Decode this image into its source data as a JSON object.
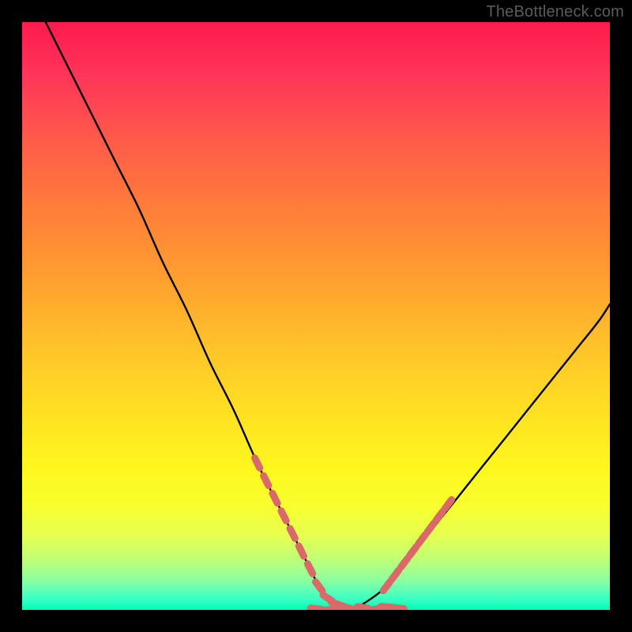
{
  "watermark": "TheBottleneck.com",
  "chart_data": {
    "type": "line",
    "title": "",
    "xlabel": "",
    "ylabel": "",
    "xlim": [
      0,
      100
    ],
    "ylim": [
      0,
      100
    ],
    "grid": false,
    "legend": false,
    "series": [
      {
        "name": "curve",
        "x": [
          4,
          8,
          12,
          16,
          20,
          24,
          28,
          32,
          36,
          40,
          44,
          48,
          50,
          52,
          54,
          56,
          58,
          62,
          66,
          70,
          74,
          78,
          82,
          86,
          90,
          94,
          98,
          100
        ],
        "y": [
          100,
          92,
          84,
          76,
          68,
          59,
          51,
          42,
          34,
          25,
          17,
          9,
          5,
          2,
          1,
          0,
          1,
          4,
          9,
          14,
          19,
          24,
          29,
          34,
          39,
          44,
          49,
          52
        ]
      }
    ],
    "highlight_segments": [
      {
        "name": "left-dotted",
        "x": [
          40,
          41.5,
          43,
          44.5,
          46,
          47.5,
          49,
          50.5,
          52,
          53.5,
          55,
          56.5
        ],
        "y": [
          25,
          22,
          19,
          16,
          13,
          10,
          7,
          4,
          2,
          1,
          0.5,
          0
        ]
      },
      {
        "name": "right-dotted",
        "x": [
          62,
          63.5,
          65,
          66.5,
          68,
          69.5,
          71,
          72.5
        ],
        "y": [
          4,
          6,
          8,
          10,
          12,
          14,
          16,
          18
        ]
      },
      {
        "name": "bottom-dotted",
        "x": [
          50,
          52,
          54,
          56,
          58,
          60,
          62,
          64
        ],
        "y": [
          0.2,
          0.0,
          0.3,
          0.0,
          0.4,
          0.1,
          0.5,
          0.3
        ]
      }
    ],
    "colors": {
      "curve": "#000000",
      "highlight": "#da6a6a"
    }
  }
}
